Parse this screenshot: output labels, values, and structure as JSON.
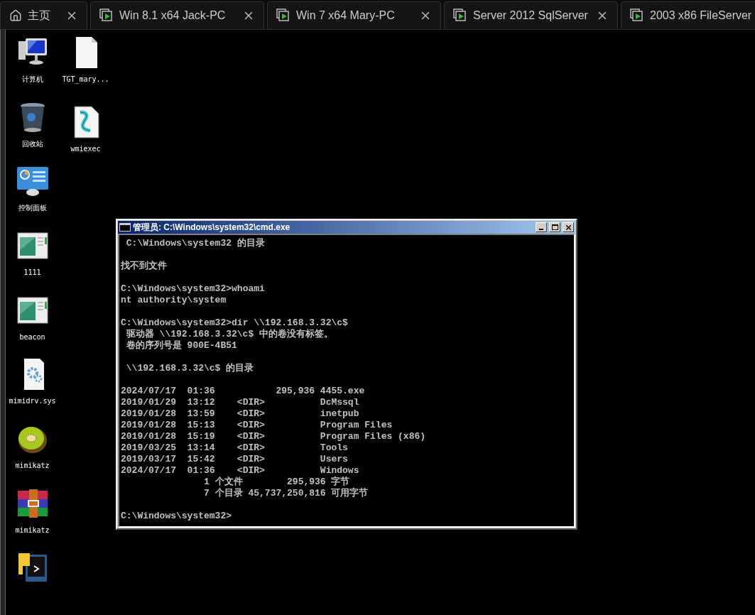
{
  "tabs": [
    {
      "kind": "home",
      "label": "主页"
    },
    {
      "kind": "vm",
      "label": "Win 8.1 x64 Jack-PC"
    },
    {
      "kind": "vm",
      "label": "Win 7 x64 Mary-PC"
    },
    {
      "kind": "vm",
      "label": "Server 2012 SqlServer"
    },
    {
      "kind": "vm",
      "label": "2003 x86 FileServer"
    }
  ],
  "desktop_columns": [
    [
      {
        "kind": "computer",
        "label": "计算机"
      },
      {
        "kind": "recycle",
        "label": "回收站"
      },
      {
        "kind": "control",
        "label": "控制面板"
      },
      {
        "kind": "app",
        "label": "1111"
      },
      {
        "kind": "app",
        "label": "beacon"
      },
      {
        "kind": "sys",
        "label": "mimidrv.sys"
      },
      {
        "kind": "kiwi",
        "label": "mimikatz"
      },
      {
        "kind": "rar",
        "label": "mimikatz"
      },
      {
        "kind": "python"
      }
    ],
    [
      {
        "kind": "file",
        "label": "TGT_mary..."
      },
      {
        "kind": "script",
        "label": "wmiexec"
      }
    ]
  ],
  "console": {
    "title": "管理员: C:\\Windows\\system32\\cmd.exe",
    "blocks": [
      [
        " C:\\Windows\\system32 的目录"
      ],
      [
        "找不到文件"
      ],
      [
        "C:\\Windows\\system32>whoami",
        "nt authority\\system"
      ],
      [
        "C:\\Windows\\system32>dir \\\\192.168.3.32\\c$",
        " 驱动器 \\\\192.168.3.32\\c$ 中的卷没有标签。",
        " 卷的序列号是 900E-4B51"
      ],
      [
        " \\\\192.168.3.32\\c$ 的目录"
      ],
      [
        "2024/07/17  01:36           295,936 4455.exe",
        "2019/01/29  13:12    <DIR>          DcMssql",
        "2019/01/28  13:59    <DIR>          inetpub",
        "2019/01/28  15:13    <DIR>          Program Files",
        "2019/01/28  15:19    <DIR>          Program Files (x86)",
        "2019/03/25  13:14    <DIR>          Tools",
        "2019/03/17  15:42    <DIR>          Users",
        "2024/07/17  01:36    <DIR>          Windows",
        "               1 个文件        295,936 字节",
        "               7 个目录 45,737,250,816 可用字节"
      ],
      [
        "C:\\Windows\\system32>"
      ]
    ]
  }
}
